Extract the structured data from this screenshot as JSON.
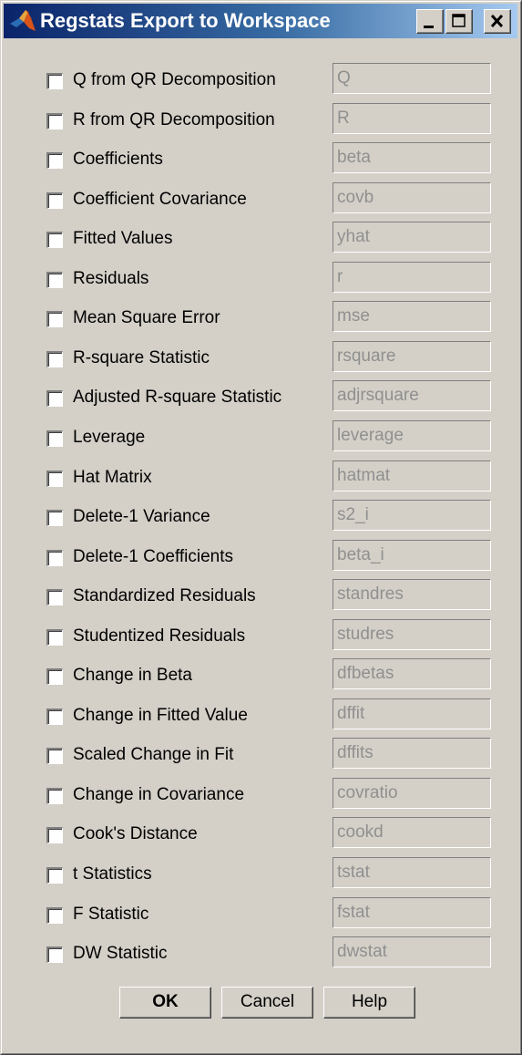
{
  "window": {
    "title": "Regstats Export to Workspace"
  },
  "titlebar_buttons": {
    "minimize_icon": "minimize-icon",
    "maximize_icon": "maximize-icon",
    "close_icon": "close-icon"
  },
  "options": [
    {
      "label": "Q from QR Decomposition",
      "variable": "Q",
      "checked": false
    },
    {
      "label": "R from QR Decomposition",
      "variable": "R",
      "checked": false
    },
    {
      "label": "Coefficients",
      "variable": "beta",
      "checked": false
    },
    {
      "label": "Coefficient Covariance",
      "variable": "covb",
      "checked": false
    },
    {
      "label": "Fitted Values",
      "variable": "yhat",
      "checked": false
    },
    {
      "label": "Residuals",
      "variable": "r",
      "checked": false
    },
    {
      "label": "Mean Square Error",
      "variable": "mse",
      "checked": false
    },
    {
      "label": "R-square Statistic",
      "variable": "rsquare",
      "checked": false
    },
    {
      "label": "Adjusted R-square Statistic",
      "variable": "adjrsquare",
      "checked": false
    },
    {
      "label": "Leverage",
      "variable": "leverage",
      "checked": false
    },
    {
      "label": "Hat Matrix",
      "variable": "hatmat",
      "checked": false
    },
    {
      "label": "Delete-1 Variance",
      "variable": "s2_i",
      "checked": false
    },
    {
      "label": "Delete-1 Coefficients",
      "variable": "beta_i",
      "checked": false
    },
    {
      "label": "Standardized Residuals",
      "variable": "standres",
      "checked": false
    },
    {
      "label": "Studentized Residuals",
      "variable": "studres",
      "checked": false
    },
    {
      "label": "Change in Beta",
      "variable": "dfbetas",
      "checked": false
    },
    {
      "label": "Change in Fitted Value",
      "variable": "dffit",
      "checked": false
    },
    {
      "label": "Scaled Change in Fit",
      "variable": "dffits",
      "checked": false
    },
    {
      "label": "Change in Covariance",
      "variable": "covratio",
      "checked": false
    },
    {
      "label": "Cook's Distance",
      "variable": "cookd",
      "checked": false
    },
    {
      "label": "t Statistics",
      "variable": "tstat",
      "checked": false
    },
    {
      "label": "F Statistic",
      "variable": "fstat",
      "checked": false
    },
    {
      "label": "DW Statistic",
      "variable": "dwstat",
      "checked": false
    }
  ],
  "buttons": {
    "ok": "OK",
    "cancel": "Cancel",
    "help": "Help"
  },
  "colors": {
    "titlebar_start": "#0a246a",
    "titlebar_end": "#a6caf0",
    "face": "#d4d0c8",
    "disabled_text": "#909090"
  }
}
